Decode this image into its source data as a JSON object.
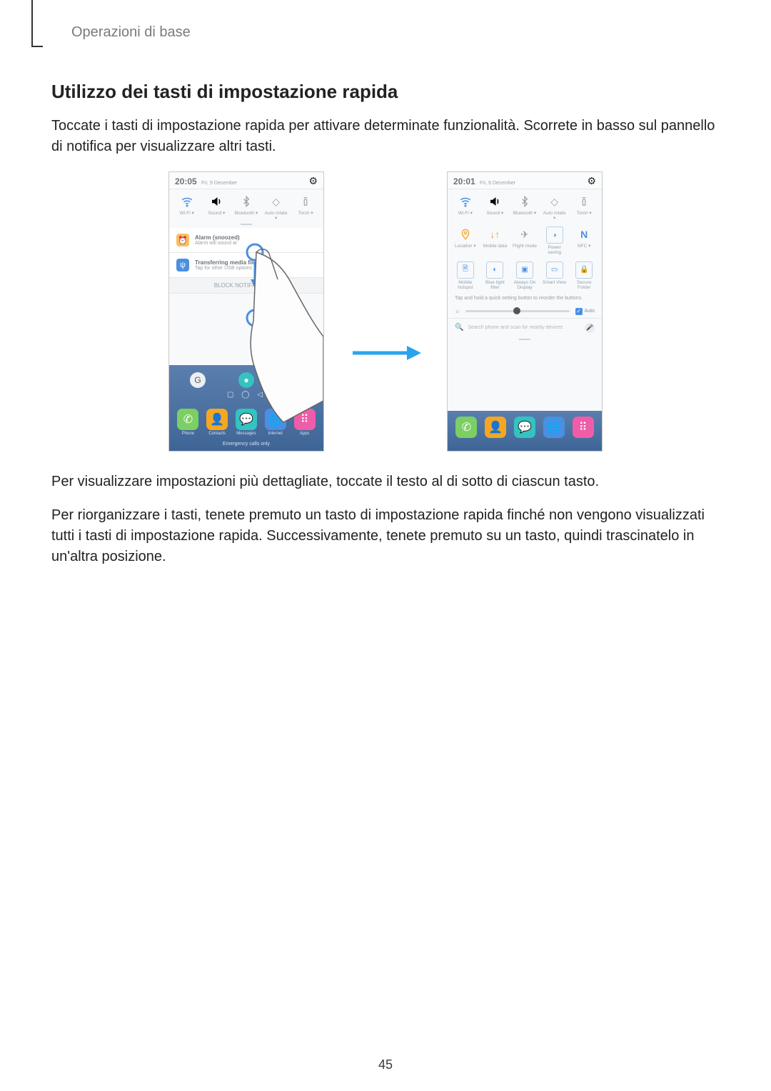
{
  "breadcrumb": "Operazioni di base",
  "section_title": "Utilizzo dei tasti di impostazione rapida",
  "intro_text": "Toccate i tasti di impostazione rapida per attivare determinate funzionalità. Scorrete in basso sul pannello di notifica per visualizzare altri tasti.",
  "after_para1": "Per visualizzare impostazioni più dettagliate, toccate il testo al di sotto di ciascun tasto.",
  "after_para2": "Per riorganizzare i tasti, tenete premuto un tasto di impostazione rapida finché non vengono visualizzati tutti i tasti di impostazione rapida. Successivamente, tenete premuto su un tasto, quindi trascinatelo in un'altra posizione.",
  "page_number": "45",
  "left_mock": {
    "time": "20:05",
    "date": "Fri, 9 December",
    "qs_row1": [
      {
        "icon": "wifi",
        "label": "Wi-Fi ▾"
      },
      {
        "icon": "sound",
        "label": "Sound ▾"
      },
      {
        "icon": "bluetooth",
        "label": "Bluetooth ▾"
      },
      {
        "icon": "rotate",
        "label": "Auto rotate ▾"
      },
      {
        "icon": "torch",
        "label": "Torch ▾"
      }
    ],
    "notif1": {
      "title": "Alarm (snoozed)",
      "sub": "Alarm will sound at"
    },
    "notif2": {
      "title": "Transferring media files",
      "sub": "Tap for other USB options"
    },
    "block": "BLOCK NOTIFICATIONS",
    "apps_mid": [
      "G",
      "●",
      "▶"
    ],
    "nav": "▢  ◯  ◁",
    "dock": [
      "phone",
      "contacts",
      "messages",
      "internet",
      "apps"
    ],
    "emerg": "Emergency calls only"
  },
  "right_mock": {
    "time": "20:01",
    "date": "Fri, 9 December",
    "qs_row1": [
      {
        "icon": "wifi",
        "label": "Wi-Fi ▾"
      },
      {
        "icon": "sound",
        "label": "Sound ▾"
      },
      {
        "icon": "bluetooth",
        "label": "Bluetooth ▾"
      },
      {
        "icon": "rotate",
        "label": "Auto rotate ▾"
      },
      {
        "icon": "torch",
        "label": "Torch ▾"
      }
    ],
    "qs_row2": [
      {
        "icon": "location",
        "label": "Location ▾"
      },
      {
        "icon": "mobiledata",
        "label": "Mobile data"
      },
      {
        "icon": "flight",
        "label": "Flight mode"
      },
      {
        "icon": "power",
        "label": "Power saving"
      },
      {
        "icon": "nfc",
        "label": "NFC ▾"
      }
    ],
    "qs_row3": [
      {
        "icon": "hotspot",
        "label": "Mobile hotspot"
      },
      {
        "icon": "bluelight",
        "label": "Blue light filter"
      },
      {
        "icon": "alwayson",
        "label": "Always On Display"
      },
      {
        "icon": "smartview",
        "label": "Smart View"
      },
      {
        "icon": "secure",
        "label": "Secure Folder"
      }
    ],
    "hint": "Tap and hold a quick setting button to reorder the buttons.",
    "auto": "Auto",
    "search": "Search phone and scan for nearby devices",
    "dock": [
      "phone",
      "contacts",
      "messages",
      "internet",
      "apps"
    ]
  }
}
